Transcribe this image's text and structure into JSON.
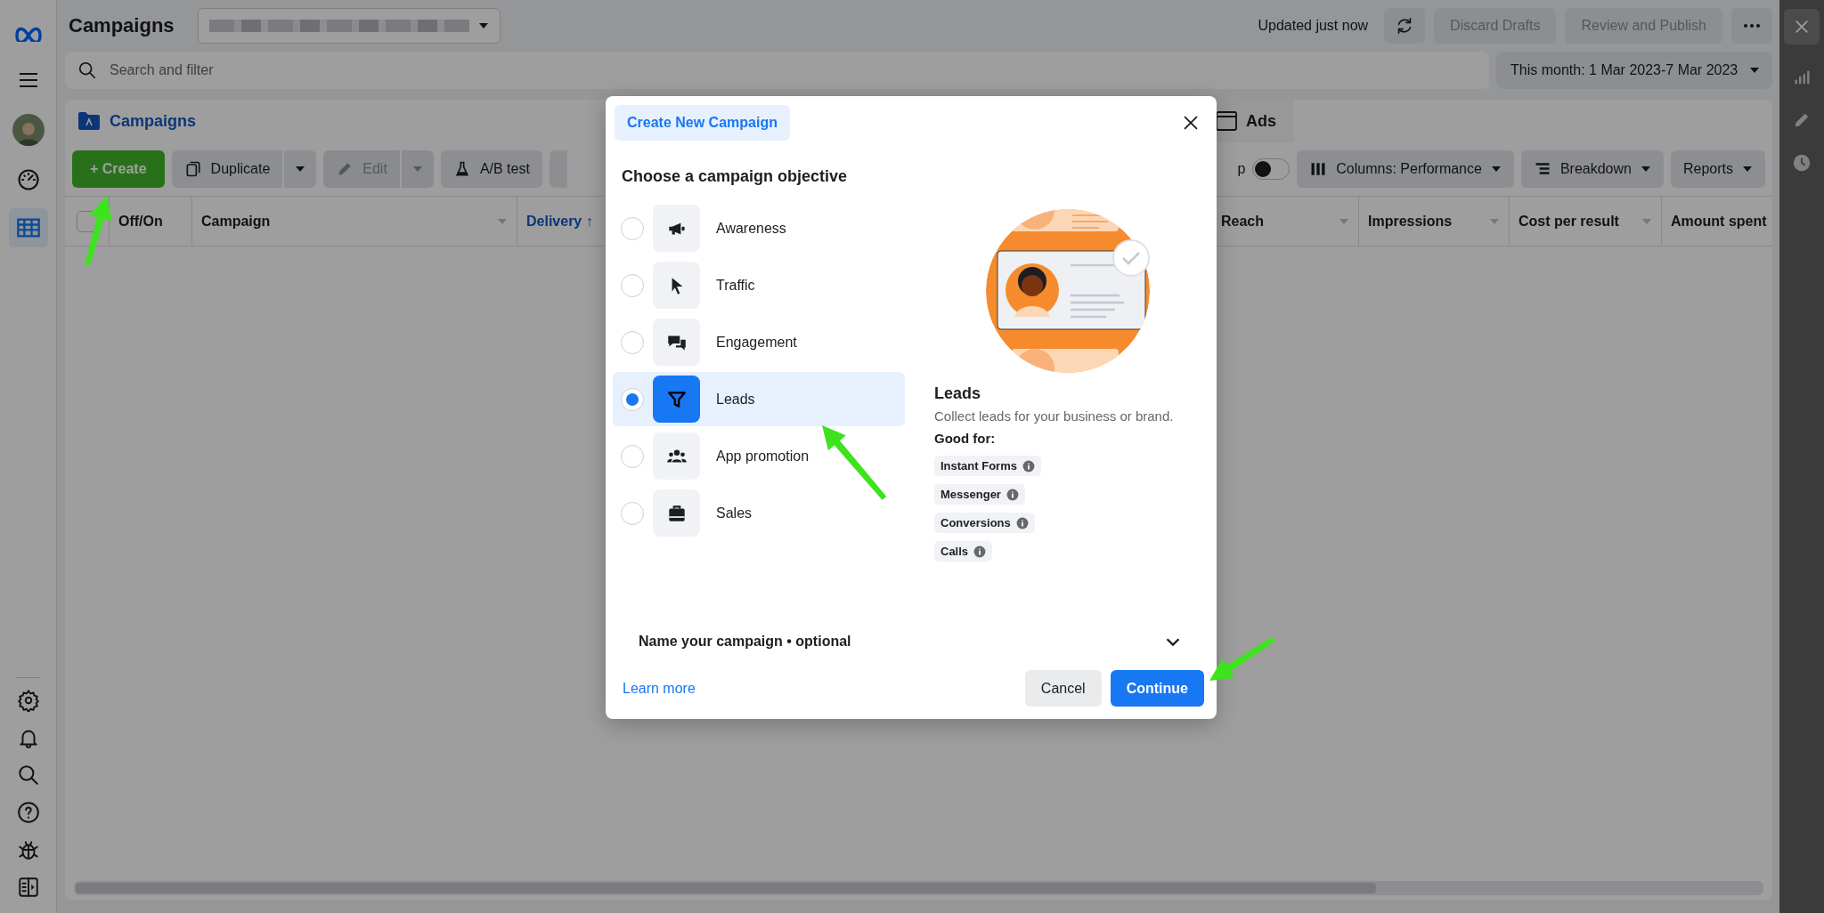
{
  "header": {
    "title": "Campaigns",
    "status": "Updated just now",
    "buttons": [
      {
        "label": "Discard Drafts",
        "disabled": true
      },
      {
        "label": "Review and Publish",
        "disabled": true
      }
    ]
  },
  "sidebar": {
    "top_items": [
      {
        "selected": false
      },
      {
        "selected": true
      }
    ]
  },
  "search": {
    "placeholder": "Search and filter"
  },
  "date_range": {
    "value": "This month: 1 Mar 2023-7 Mar 2023"
  },
  "tabs": [
    {
      "label": "Campaigns",
      "selected": true
    },
    {
      "label": "Ads",
      "selected": false
    }
  ],
  "toolbar": {
    "left": [
      {
        "kind": "create",
        "label": "+ Create"
      },
      {
        "kind": "split",
        "label": "Duplicate",
        "disabled": false
      },
      {
        "kind": "split",
        "label": "Edit",
        "disabled": true
      },
      {
        "kind": "plain",
        "label": "A/B test"
      }
    ],
    "toggle": {
      "label": "p",
      "on": false
    },
    "right": [
      {
        "label": "Columns: Performance"
      },
      {
        "label": "Breakdown"
      },
      {
        "label": "Reports"
      }
    ]
  },
  "table": {
    "select_all": {
      "checked": false
    },
    "columns": [
      {
        "label": "Off/On",
        "sorted": false
      },
      {
        "label": "Campaign",
        "sorted": false
      },
      {
        "label": "Delivery ↑",
        "sorted": true
      },
      {
        "label": "Reach",
        "sorted": false
      },
      {
        "label": "Impressions",
        "sorted": false
      },
      {
        "label": "Cost per result",
        "sorted": false
      },
      {
        "label": "Amount spent",
        "sorted": false
      }
    ]
  },
  "modal": {
    "tab": "Create New Campaign",
    "heading": "Choose a campaign objective",
    "objectives": [
      {
        "label": "Awareness",
        "selected": false
      },
      {
        "label": "Traffic",
        "selected": false
      },
      {
        "label": "Engagement",
        "selected": false
      },
      {
        "label": "Leads",
        "selected": true
      },
      {
        "label": "App promotion",
        "selected": false
      },
      {
        "label": "Sales",
        "selected": false
      }
    ],
    "detail": {
      "title": "Leads",
      "description": "Collect leads for your business or brand.",
      "good_for_label": "Good for:",
      "tags": [
        "Instant Forms",
        "Messenger",
        "Conversions",
        "Calls"
      ]
    },
    "name_section": {
      "label": "Name your campaign • optional",
      "expanded": false
    },
    "learn_more": "Learn more",
    "buttons": [
      {
        "label": "Cancel",
        "kind": "secondary"
      },
      {
        "label": "Continue",
        "kind": "primary"
      }
    ]
  }
}
